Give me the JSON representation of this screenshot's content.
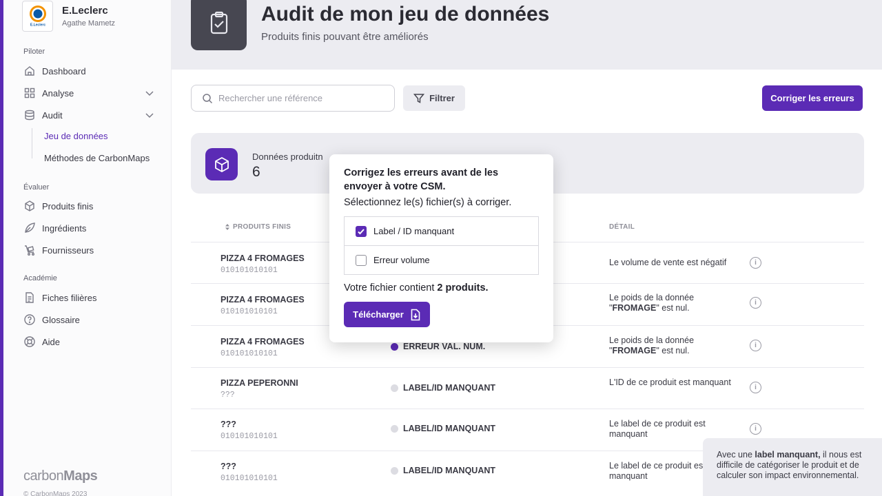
{
  "brand": {
    "name": "E.Leclerc",
    "user": "Agathe Mametz",
    "logo_text": "E.Leclerc"
  },
  "sidebar": {
    "sections": [
      {
        "title": "Piloter"
      },
      {
        "title": "Évaluer"
      },
      {
        "title": "Académie"
      }
    ],
    "items": [
      {
        "label": "Dashboard",
        "icon": "home-icon"
      },
      {
        "label": "Analyse",
        "icon": "grid-icon"
      },
      {
        "label": "Audit",
        "icon": "database-icon"
      },
      {
        "label": "Produits finis",
        "icon": "box-icon"
      },
      {
        "label": "Ingrédients",
        "icon": "leaf-icon"
      },
      {
        "label": "Fournisseurs",
        "icon": "truck-icon"
      },
      {
        "label": "Fiches filières",
        "icon": "document-icon"
      },
      {
        "label": "Glossaire",
        "icon": "help-icon"
      },
      {
        "label": "Aide",
        "icon": "lifebuoy-icon"
      }
    ],
    "subitems": [
      {
        "label": "Jeu de données",
        "active": true
      },
      {
        "label": "Méthodes de CarbonMaps",
        "active": false
      }
    ],
    "footer_logo": {
      "part1": "carbon",
      "part2": "Maps"
    },
    "footer_text": "© CarbonMaps 2023"
  },
  "header": {
    "title": "Audit de mon jeu de données",
    "subtitle": "Produits finis pouvant être améliorés"
  },
  "toolbar": {
    "search_placeholder": "Rechercher une référence",
    "filter_label": "Filtrer",
    "correct_label": "Corriger les erreurs"
  },
  "summary": {
    "label": "Données produitn",
    "value": "6"
  },
  "table": {
    "headers": {
      "product": "PRODUITS FINIS",
      "detail": "DÉTAIL"
    },
    "rows": [
      {
        "product": "PIZZA 4 FROMAGES",
        "ref": "010101010101",
        "error": "",
        "detail_pre": "Le volume de vente est négatif",
        "detail_bold": "",
        "detail_post": ""
      },
      {
        "product": "PIZZA 4 FROMAGES",
        "ref": "010101010101",
        "error": "",
        "detail_pre": "Le poids de la donnée \"",
        "detail_bold": "FROMAGE",
        "detail_post": "\" est nul."
      },
      {
        "product": "PIZZA 4 FROMAGES",
        "ref": "010101010101",
        "error": "ERREUR VAL. NUM.",
        "error_color": "#5b2bb5",
        "detail_pre": "Le poids de la donnée \"",
        "detail_bold": "FROMAGE",
        "detail_post": "\" est nul."
      },
      {
        "product": "PIZZA PEPERONNI",
        "ref": "???",
        "error": "LABEL/ID MANQUANT",
        "error_color": "#dcdce2",
        "detail_pre": "L'ID de ce produit est manquant",
        "detail_bold": "",
        "detail_post": ""
      },
      {
        "product": "???",
        "ref": "010101010101",
        "error": "LABEL/ID MANQUANT",
        "error_color": "#dcdce2",
        "detail_pre": "Le label de ce produit est manquant",
        "detail_bold": "",
        "detail_post": ""
      },
      {
        "product": "???",
        "ref": "010101010101",
        "error": "LABEL/ID MANQUANT",
        "error_color": "#dcdce2",
        "detail_pre": "Le label de ce produit est manquant",
        "detail_bold": "",
        "detail_post": ""
      }
    ]
  },
  "modal": {
    "title": "Corrigez les erreurs avant de les envoyer à votre CSM.",
    "subtitle": "Sélectionnez le(s) fichier(s) à corriger.",
    "options": [
      {
        "label": "Label / ID manquant",
        "checked": true
      },
      {
        "label": "Erreur volume",
        "checked": false
      }
    ],
    "count_pre": "Votre fichier contient",
    "count_bold": "2 produits.",
    "download_label": "Télécharger"
  },
  "tooltip": {
    "pre": "Avec une",
    "bold": "label manquant,",
    "post": "il nous est difficile de catégoriser le produit et de calculer son impact environnemental."
  },
  "colors": {
    "accent": "#5b2bb5",
    "panel": "#ececf1",
    "header_icon": "#474751"
  }
}
